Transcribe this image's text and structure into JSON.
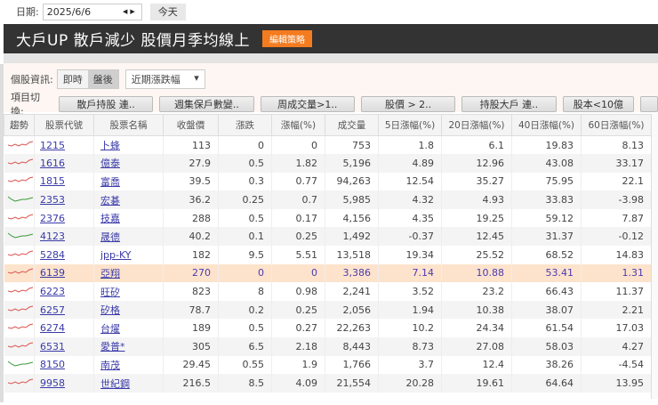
{
  "date_bar": {
    "label": "日期:",
    "date": "2025/6/6",
    "today_label": "今天"
  },
  "title": {
    "text": "大戶UP 散戶減少 股價月季均線上",
    "edit_label": "編輯策略"
  },
  "info": {
    "label": "個股資訊:",
    "realtime": "即時",
    "after_hours": "盤後",
    "select_value": "近期漲跌幅"
  },
  "switch": {
    "label": "項目切換:",
    "buttons": [
      "散戶持股 連..",
      "週集保戶數變..",
      "周成交量>1..",
      "股價 > 2..",
      "持股大戶 連..",
      "股本<10億"
    ]
  },
  "columns": [
    "趨勢",
    "股票代號",
    "股票名稱",
    "收盤價",
    "漲跌",
    "漲幅(%)",
    "成交量",
    "5日漲幅(%)",
    "20日漲幅(%)",
    "40日漲幅(%)",
    "60日漲幅(%)"
  ],
  "colors": {
    "up": "#d9534f",
    "down": "#3a9a3a",
    "highlight": "#fde3cc",
    "accent": "#f47c20"
  },
  "rows": [
    {
      "trend": "up",
      "code": "1215",
      "name": "卜蜂",
      "close": "113",
      "chg": "0",
      "pct": "0",
      "vol": "753",
      "d5": "1.8",
      "d20": "6.1",
      "d40": "19.83",
      "d60": "8.13"
    },
    {
      "trend": "up",
      "code": "1616",
      "name": "億泰",
      "close": "27.9",
      "chg": "0.5",
      "pct": "1.82",
      "vol": "5,196",
      "d5": "4.89",
      "d20": "12.96",
      "d40": "43.08",
      "d60": "33.17"
    },
    {
      "trend": "up",
      "code": "1815",
      "name": "富喬",
      "close": "39.5",
      "chg": "0.3",
      "pct": "0.77",
      "vol": "94,263",
      "d5": "12.54",
      "d20": "35.27",
      "d40": "75.95",
      "d60": "22.1"
    },
    {
      "trend": "down",
      "code": "2353",
      "name": "宏碁",
      "close": "36.2",
      "chg": "0.25",
      "pct": "0.7",
      "vol": "5,985",
      "d5": "4.32",
      "d20": "4.93",
      "d40": "33.83",
      "d60": "-3.98"
    },
    {
      "trend": "up",
      "code": "2376",
      "name": "技嘉",
      "close": "288",
      "chg": "0.5",
      "pct": "0.17",
      "vol": "4,156",
      "d5": "4.35",
      "d20": "19.25",
      "d40": "59.12",
      "d60": "7.87"
    },
    {
      "trend": "down",
      "code": "4123",
      "name": "晟德",
      "close": "40.2",
      "chg": "0.1",
      "pct": "0.25",
      "vol": "1,492",
      "d5": "-0.37",
      "d20": "12.45",
      "d40": "31.37",
      "d60": "-0.12"
    },
    {
      "trend": "up",
      "code": "5284",
      "name": "jpp-KY",
      "close": "182",
      "chg": "9.5",
      "pct": "5.51",
      "vol": "13,518",
      "d5": "19.34",
      "d20": "25.52",
      "d40": "68.52",
      "d60": "14.83"
    },
    {
      "trend": "up",
      "code": "6139",
      "name": "亞翔",
      "close": "270",
      "chg": "0",
      "pct": "0",
      "vol": "3,386",
      "d5": "7.14",
      "d20": "10.88",
      "d40": "53.41",
      "d60": "1.31",
      "selected": true
    },
    {
      "trend": "up",
      "code": "6223",
      "name": "旺矽",
      "close": "823",
      "chg": "8",
      "pct": "0.98",
      "vol": "2,241",
      "d5": "3.52",
      "d20": "23.2",
      "d40": "66.43",
      "d60": "11.37"
    },
    {
      "trend": "up",
      "code": "6257",
      "name": "矽格",
      "close": "78.7",
      "chg": "0.2",
      "pct": "0.25",
      "vol": "2,056",
      "d5": "1.94",
      "d20": "10.38",
      "d40": "38.07",
      "d60": "2.21"
    },
    {
      "trend": "up",
      "code": "6274",
      "name": "台燿",
      "close": "189",
      "chg": "0.5",
      "pct": "0.27",
      "vol": "22,263",
      "d5": "10.2",
      "d20": "24.34",
      "d40": "61.54",
      "d60": "17.03"
    },
    {
      "trend": "up",
      "code": "6531",
      "name": "愛普*",
      "close": "305",
      "chg": "6.5",
      "pct": "2.18",
      "vol": "8,443",
      "d5": "8.73",
      "d20": "27.08",
      "d40": "58.03",
      "d60": "4.27"
    },
    {
      "trend": "down",
      "code": "8150",
      "name": "南茂",
      "close": "29.45",
      "chg": "0.55",
      "pct": "1.9",
      "vol": "1,766",
      "d5": "3.7",
      "d20": "12.4",
      "d40": "38.26",
      "d60": "-4.54"
    },
    {
      "trend": "up",
      "code": "9958",
      "name": "世紀鋼",
      "close": "216.5",
      "chg": "8.5",
      "pct": "4.09",
      "vol": "21,554",
      "d5": "20.28",
      "d20": "19.61",
      "d40": "64.64",
      "d60": "13.95"
    }
  ]
}
